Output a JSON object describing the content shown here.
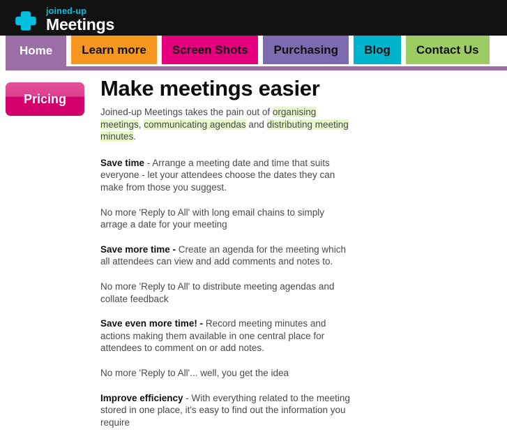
{
  "header": {
    "logo_tagline": "joined-up",
    "logo_name": "Meetings",
    "logo_icon": "cross-plus-icon",
    "background": "#121212",
    "accent": "#00c0e0"
  },
  "nav": {
    "underline_color": "#9b6ea5",
    "items": [
      {
        "label": "Home",
        "bg": "#9b6ea5",
        "fg": "#ffffff",
        "active": true
      },
      {
        "label": "Learn more",
        "bg": "#f5971e",
        "fg": "#111111",
        "active": false
      },
      {
        "label": "Screen Shots",
        "bg": "#e6007e",
        "fg": "#111111",
        "active": false
      },
      {
        "label": "Purchasing",
        "bg": "#7d6bb0",
        "fg": "#111111",
        "active": false
      },
      {
        "label": "Blog",
        "bg": "#00b4cd",
        "fg": "#111111",
        "active": false
      },
      {
        "label": "Contact Us",
        "bg": "#9ccc64",
        "fg": "#111111",
        "active": false
      }
    ]
  },
  "sidebar": {
    "pricing_label": "Pricing",
    "pricing_color_top": "#e1539a",
    "pricing_color_bottom": "#d3006c"
  },
  "main": {
    "title": "Make meetings easier",
    "highlight_color": "#e9f7cb",
    "intro": {
      "part1": "Joined-up Meetings takes the pain out of ",
      "hl1": "organising meetings",
      "part2": ", ",
      "hl2": "communicating agendas",
      "part3": " and ",
      "hl3": "distributing meeting minutes",
      "part4": "."
    },
    "sections": [
      {
        "lead": "Save time",
        "body": " - Arrange a meeting date and time that suits everyone - let your attendees choose the dates they can make from those you suggest."
      },
      {
        "lead": "",
        "body": "No more 'Reply to All' with long email chains to simply arrage a date for your meeting"
      },
      {
        "lead": "Save more time -",
        "body": " Create an agenda for the meeting which all attendees can view and add comments and notes to."
      },
      {
        "lead": "",
        "body": "No more 'Reply to All' to distribute meeting agendas and collate feedback"
      },
      {
        "lead": "Save even more time! -",
        "body": " Record meeting minutes and actions making them available in one central place for attendees to comment on or add notes."
      },
      {
        "lead": "",
        "body": "No more 'Reply to All'... well, you get the idea"
      },
      {
        "lead": "Improve efficiency",
        "body": " - With everything related to the meeting stored in one place, it's easy to find out the information you require"
      }
    ]
  }
}
